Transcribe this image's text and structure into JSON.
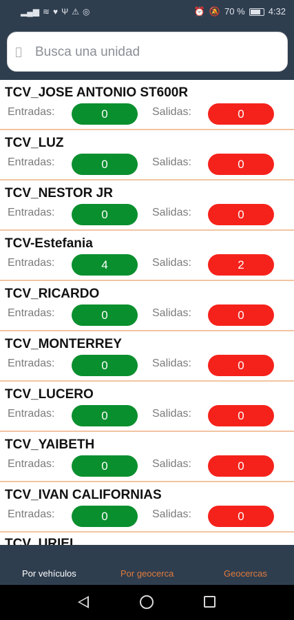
{
  "status_bar": {
    "battery_percent": "70 %",
    "time": "4:32",
    "left_icons": [
      "signal-icon",
      "wifi-icon",
      "heart-icon",
      "usb-icon",
      "warning-icon",
      "whatsapp-icon"
    ],
    "right_icons": [
      "alarm-icon",
      "mute-icon",
      "battery-icon"
    ]
  },
  "search": {
    "placeholder": "Busca una unidad",
    "value": ""
  },
  "labels": {
    "entradas": "Entradas:",
    "salidas": "Salidas:"
  },
  "colors": {
    "header_bg": "#2f3e4f",
    "entradas_pill": "#0a8f2e",
    "salidas_pill": "#f5221b",
    "divider": "#f2c4a0",
    "tab_active": "#ffffff",
    "tab_inactive": "#e07a3b"
  },
  "units": [
    {
      "name": "TCV_JOSE ANTONIO ST600R",
      "entradas": "0",
      "salidas": "0"
    },
    {
      "name": "TCV_LUZ",
      "entradas": "0",
      "salidas": "0"
    },
    {
      "name": "TCV_NESTOR JR",
      "entradas": "0",
      "salidas": "0"
    },
    {
      "name": "TCV-Estefania",
      "entradas": "4",
      "salidas": "2"
    },
    {
      "name": "TCV_RICARDO",
      "entradas": "0",
      "salidas": "0"
    },
    {
      "name": "TCV_MONTERREY",
      "entradas": "0",
      "salidas": "0"
    },
    {
      "name": "TCV_LUCERO",
      "entradas": "0",
      "salidas": "0"
    },
    {
      "name": "TCV_YAIBETH",
      "entradas": "0",
      "salidas": "0"
    },
    {
      "name": "TCV_IVAN CALIFORNIAS",
      "entradas": "0",
      "salidas": "0"
    }
  ],
  "partial_unit": {
    "name": "TCV_URIEL"
  },
  "tabs": [
    {
      "label": "Por vehículos",
      "active": true
    },
    {
      "label": "Por geocerca",
      "active": false
    },
    {
      "label": "Geocercas",
      "active": false
    }
  ]
}
